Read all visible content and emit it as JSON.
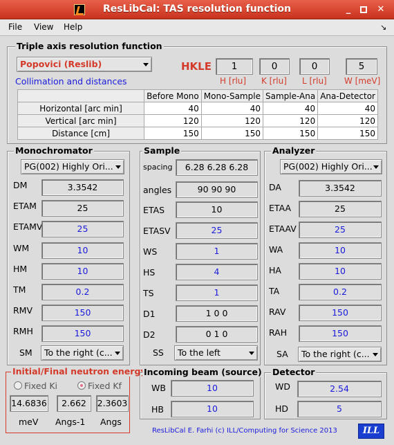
{
  "window": {
    "title": "ResLibCal: TAS resolution function"
  },
  "menu": {
    "file": "File",
    "view": "View",
    "help": "Help",
    "corner": "↘"
  },
  "main": {
    "group_title": "Triple axis resolution function",
    "method": "Popovici (Reslib)",
    "collimation_link": "Collimation and distances",
    "hkle_label": "HKLE",
    "hkle": [
      {
        "value": "1",
        "unit": "H [rlu]"
      },
      {
        "value": "0",
        "unit": "K [rlu]"
      },
      {
        "value": "0",
        "unit": "L [rlu]"
      },
      {
        "value": "5",
        "unit": "W [meV]"
      }
    ],
    "table": {
      "columns": [
        "Before Mono",
        "Mono-Sample",
        "Sample-Ana",
        "Ana-Detector"
      ],
      "rows": [
        {
          "label": "Horizontal [arc min]",
          "values": [
            "40",
            "40",
            "40",
            "40"
          ]
        },
        {
          "label": "Vertical [arc min]",
          "values": [
            "120",
            "120",
            "120",
            "120"
          ]
        },
        {
          "label": "Distance [cm]",
          "values": [
            "150",
            "150",
            "150",
            "150"
          ]
        }
      ]
    }
  },
  "mono": {
    "title": "Monochromator",
    "crystal": "PG(002) Highly Ori...",
    "fields": [
      {
        "label": "DM",
        "value": "3.3542",
        "color": "black"
      },
      {
        "label": "ETAM",
        "value": "25",
        "color": "black"
      },
      {
        "label": "ETAMV",
        "value": "25",
        "color": "blue"
      },
      {
        "label": "WM",
        "value": "10",
        "color": "blue"
      },
      {
        "label": "HM",
        "value": "10",
        "color": "blue"
      },
      {
        "label": "TM",
        "value": "0.2",
        "color": "blue"
      },
      {
        "label": "RMV",
        "value": "150",
        "color": "blue"
      },
      {
        "label": "RMH",
        "value": "150",
        "color": "blue"
      }
    ],
    "sm_label": "SM",
    "sm_value": "To the right (c..."
  },
  "sample": {
    "title": "Sample",
    "fields": [
      {
        "label": "spacing",
        "value": "6.28 6.28 6.28",
        "color": "black"
      },
      {
        "label": "angles",
        "value": "90 90 90",
        "color": "black"
      },
      {
        "label": "ETAS",
        "value": "10",
        "color": "black"
      },
      {
        "label": "ETASV",
        "value": "25",
        "color": "blue"
      },
      {
        "label": "WS",
        "value": "1",
        "color": "blue"
      },
      {
        "label": "HS",
        "value": "4",
        "color": "blue"
      },
      {
        "label": "TS",
        "value": "1",
        "color": "blue"
      },
      {
        "label": "D1",
        "value": "1  0  0",
        "color": "black"
      },
      {
        "label": "D2",
        "value": "0  1  0",
        "color": "black"
      }
    ],
    "ss_label": "SS",
    "ss_value": "To the left"
  },
  "analyzer": {
    "title": "Analyzer",
    "crystal": "PG(002) Highly Ori...",
    "fields": [
      {
        "label": "DA",
        "value": "3.3542",
        "color": "black"
      },
      {
        "label": "ETAA",
        "value": "25",
        "color": "black"
      },
      {
        "label": "ETAAV",
        "value": "25",
        "color": "blue"
      },
      {
        "label": "WA",
        "value": "10",
        "color": "blue"
      },
      {
        "label": "HA",
        "value": "10",
        "color": "blue"
      },
      {
        "label": "TA",
        "value": "0.2",
        "color": "blue"
      },
      {
        "label": "RAV",
        "value": "150",
        "color": "blue"
      },
      {
        "label": "RAH",
        "value": "150",
        "color": "blue"
      }
    ],
    "sa_label": "SA",
    "sa_value": "To the right (c..."
  },
  "energy": {
    "title": "Initial/Final neutron energy",
    "fixed_ki": "Fixed Ki",
    "fixed_kf": "Fixed Kf",
    "selected": "Fixed Kf",
    "values": [
      {
        "value": "14.6836",
        "unit": "meV"
      },
      {
        "value": "2.662",
        "unit": "Angs-1"
      },
      {
        "value": "2.3603",
        "unit": "Angs"
      }
    ]
  },
  "beam": {
    "title": "Incoming beam (source)",
    "wb_label": "WB",
    "wb": "10",
    "hb_label": "HB",
    "hb": "10"
  },
  "detector": {
    "title": "Detector",
    "wd_label": "WD",
    "wd": "2.54",
    "hd_label": "HD",
    "hd": "5"
  },
  "footer": {
    "credit": "ResLibCal E. Farhi (c) ILL/Computing for Science 2013",
    "logo_text": "ILL"
  },
  "colors": {
    "title_bar": "#d94a33",
    "accent_blue": "#1a1adc",
    "accent_red": "#d43a2a"
  }
}
